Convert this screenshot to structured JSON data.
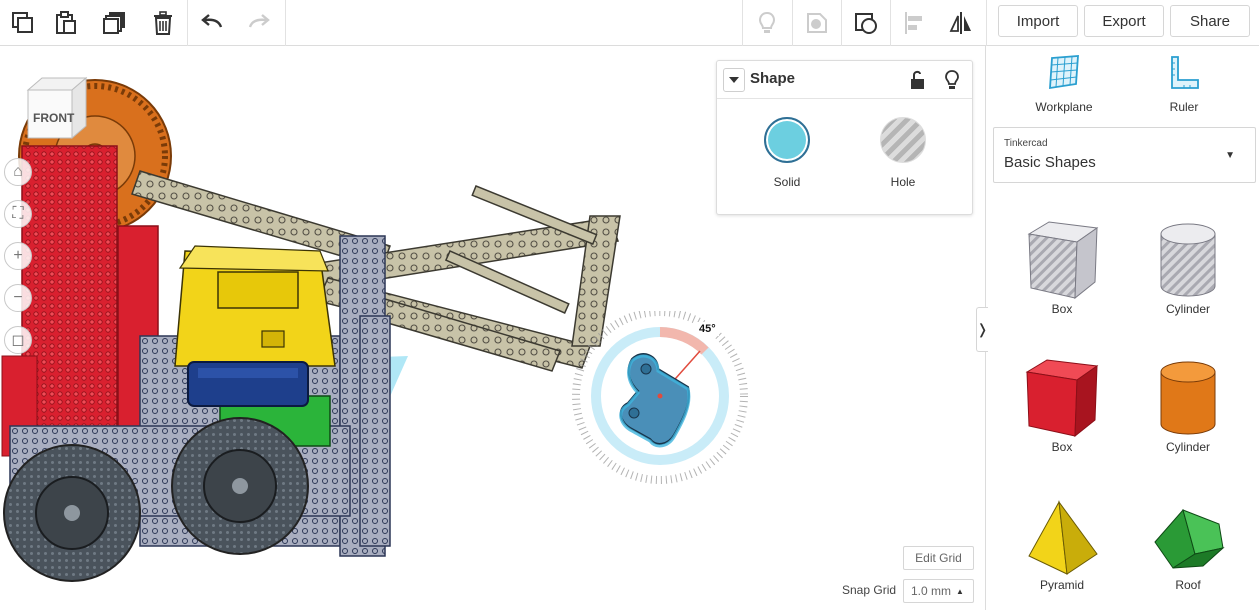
{
  "toolbar": {
    "left_icons": [
      "copy-icon",
      "paste-icon",
      "duplicate-icon",
      "delete-icon",
      "undo-icon",
      "redo-icon"
    ],
    "right_icons": [
      "show-all-icon",
      "hole-visibility-icon",
      "group-icon",
      "align-icon",
      "mirror-icon"
    ],
    "import_label": "Import",
    "export_label": "Export",
    "share_label": "Share"
  },
  "viewcube": {
    "face_label": "FRONT"
  },
  "rotation": {
    "angle_label": "45°"
  },
  "inspector": {
    "title": "Shape",
    "solid_label": "Solid",
    "hole_label": "Hole",
    "solid_color": "#6ccfe0"
  },
  "grid": {
    "edit_label": "Edit Grid",
    "snap_label": "Snap Grid",
    "snap_value": "1.0 mm"
  },
  "panel": {
    "workplane_label": "Workplane",
    "ruler_label": "Ruler",
    "library_brand": "Tinkercad",
    "library_name": "Basic Shapes",
    "shapes": [
      {
        "label": "Box",
        "kind": "hole-box"
      },
      {
        "label": "Cylinder",
        "kind": "hole-cylinder"
      },
      {
        "label": "Box",
        "kind": "red-box"
      },
      {
        "label": "Cylinder",
        "kind": "orange-cylinder"
      },
      {
        "label": "Pyramid",
        "kind": "pyramid"
      },
      {
        "label": "Roof",
        "kind": "roof"
      }
    ]
  },
  "colors": {
    "accent": "#3fb4dd",
    "selected": "#4a8fb8",
    "robot_red": "#d9202f",
    "robot_yellow": "#f2d419",
    "robot_navy": "#1e3f8c",
    "robot_green": "#2bb43a",
    "gear_orange": "#d9701d",
    "chassis_grey": "#a7acba"
  }
}
